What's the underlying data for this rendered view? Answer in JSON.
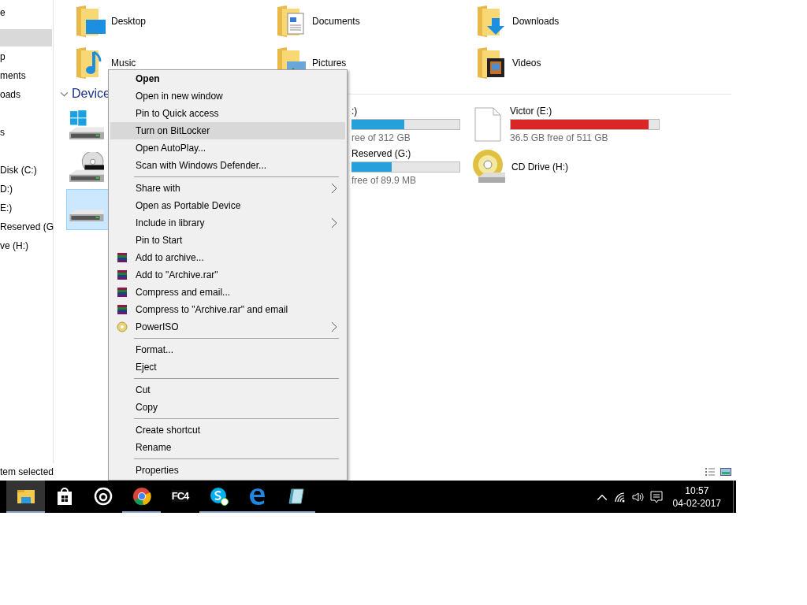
{
  "sidebar": {
    "items": [
      {
        "label": "e",
        "selected": false
      },
      {
        "selected": true
      },
      {
        "label": "p",
        "selected": false
      },
      {
        "label": "ments",
        "selected": false
      },
      {
        "label": "oads",
        "selected": false
      },
      {
        "selected": false
      },
      {
        "label": "s",
        "selected": false
      },
      {
        "selected": false
      },
      {
        "label": "Disk (C:)",
        "selected": false
      },
      {
        "label": "D:)",
        "selected": false
      },
      {
        "label": "E:)",
        "selected": false
      },
      {
        "label": "Reserved (G",
        "selected": false
      },
      {
        "label": "ve (H:)",
        "selected": false
      }
    ]
  },
  "folders": [
    {
      "name": "Desktop",
      "kind": "desktop"
    },
    {
      "name": "Documents",
      "kind": "documents"
    },
    {
      "name": "Downloads",
      "kind": "downloads"
    },
    {
      "name": "Music",
      "kind": "music"
    },
    {
      "name": "Pictures",
      "kind": "pictures"
    },
    {
      "name": "Videos",
      "kind": "videos"
    }
  ],
  "devices": {
    "header": "Device",
    "drives": [
      {
        "kind": "windows",
        "selected": false
      },
      {
        "kind": "partial",
        "name": ":)",
        "level": 0.49,
        "color": "#26a0da",
        "free": "ree of 312 GB",
        "selected": false
      },
      {
        "kind": "file",
        "name": "Victor (E:)",
        "level": 0.93,
        "color": "#da2626",
        "free": "36.5 GB free of 511 GB",
        "selected": false
      },
      {
        "kind": "dvd",
        "selected": false
      },
      {
        "kind": "partial",
        "name": "Reserved (G:)",
        "level": 0.37,
        "color": "#26a0da",
        "free": "free of 89.9 MB",
        "selected": false
      },
      {
        "kind": "cd",
        "name": "CD Drive (H:)",
        "selected": false
      },
      {
        "kind": "drive",
        "selected": true
      }
    ]
  },
  "status_bar": {
    "text": "tem selected"
  },
  "context_menu": {
    "items": [
      {
        "kind": "item",
        "label": "Open",
        "default": true,
        "selected": false,
        "submenu": false
      },
      {
        "kind": "item",
        "label": "Open in new window",
        "default": false,
        "selected": false,
        "submenu": false
      },
      {
        "kind": "item",
        "label": "Pin to Quick access",
        "default": false,
        "selected": false,
        "submenu": false
      },
      {
        "kind": "item",
        "label": "Turn on BitLocker",
        "default": false,
        "selected": true,
        "submenu": false
      },
      {
        "kind": "item",
        "label": "Open AutoPlay...",
        "default": false,
        "selected": false,
        "submenu": false
      },
      {
        "kind": "item",
        "label": "Scan with Windows Defender...",
        "default": false,
        "selected": false,
        "submenu": false
      },
      {
        "kind": "separator"
      },
      {
        "kind": "item",
        "label": "Share with",
        "default": false,
        "selected": false,
        "submenu": true
      },
      {
        "kind": "item",
        "label": "Open as Portable Device",
        "default": false,
        "selected": false,
        "submenu": false
      },
      {
        "kind": "item",
        "label": "Include in library",
        "default": false,
        "selected": false,
        "submenu": true
      },
      {
        "kind": "item",
        "label": "Pin to Start",
        "default": false,
        "selected": false,
        "submenu": false
      },
      {
        "kind": "archive",
        "label": "Add to archive...",
        "default": false,
        "selected": false,
        "submenu": false
      },
      {
        "kind": "archive",
        "label": "Add to \"Archive.rar\"",
        "default": false,
        "selected": false,
        "submenu": false
      },
      {
        "kind": "archive",
        "label": "Compress and email...",
        "default": false,
        "selected": false,
        "submenu": false
      },
      {
        "kind": "archive",
        "label": "Compress to \"Archive.rar\" and email",
        "default": false,
        "selected": false,
        "submenu": false
      },
      {
        "kind": "disc",
        "label": "PowerISO",
        "default": false,
        "selected": false,
        "submenu": true
      },
      {
        "kind": "separator"
      },
      {
        "kind": "item",
        "label": "Format...",
        "default": false,
        "selected": false,
        "submenu": false
      },
      {
        "kind": "item",
        "label": "Eject",
        "default": false,
        "selected": false,
        "submenu": false
      },
      {
        "kind": "separator"
      },
      {
        "kind": "item",
        "label": "Cut",
        "default": false,
        "selected": false,
        "submenu": false
      },
      {
        "kind": "item",
        "label": "Copy",
        "default": false,
        "selected": false,
        "submenu": false
      },
      {
        "kind": "separator"
      },
      {
        "kind": "item",
        "label": "Create shortcut",
        "default": false,
        "selected": false,
        "submenu": false
      },
      {
        "kind": "item",
        "label": "Rename",
        "default": false,
        "selected": false,
        "submenu": false
      },
      {
        "kind": "separator"
      },
      {
        "kind": "item",
        "label": "Properties",
        "default": false,
        "selected": false,
        "submenu": false
      }
    ]
  },
  "taskbar": {
    "apps": [
      {
        "kind": "explorer",
        "selected": true,
        "running": true
      },
      {
        "kind": "store",
        "selected": false,
        "running": false
      },
      {
        "kind": "ring",
        "selected": false,
        "running": false
      },
      {
        "kind": "chrome",
        "selected": false,
        "running": true
      },
      {
        "kind": "fc4",
        "label": "FC4",
        "selected": false,
        "running": false
      },
      {
        "kind": "skype",
        "selected": false,
        "running": true
      },
      {
        "kind": "edge",
        "selected": false,
        "running": true
      },
      {
        "kind": "notepad",
        "selected": false,
        "running": true
      }
    ],
    "clock": {
      "time": "10:57",
      "date": "04-02-2017"
    }
  }
}
